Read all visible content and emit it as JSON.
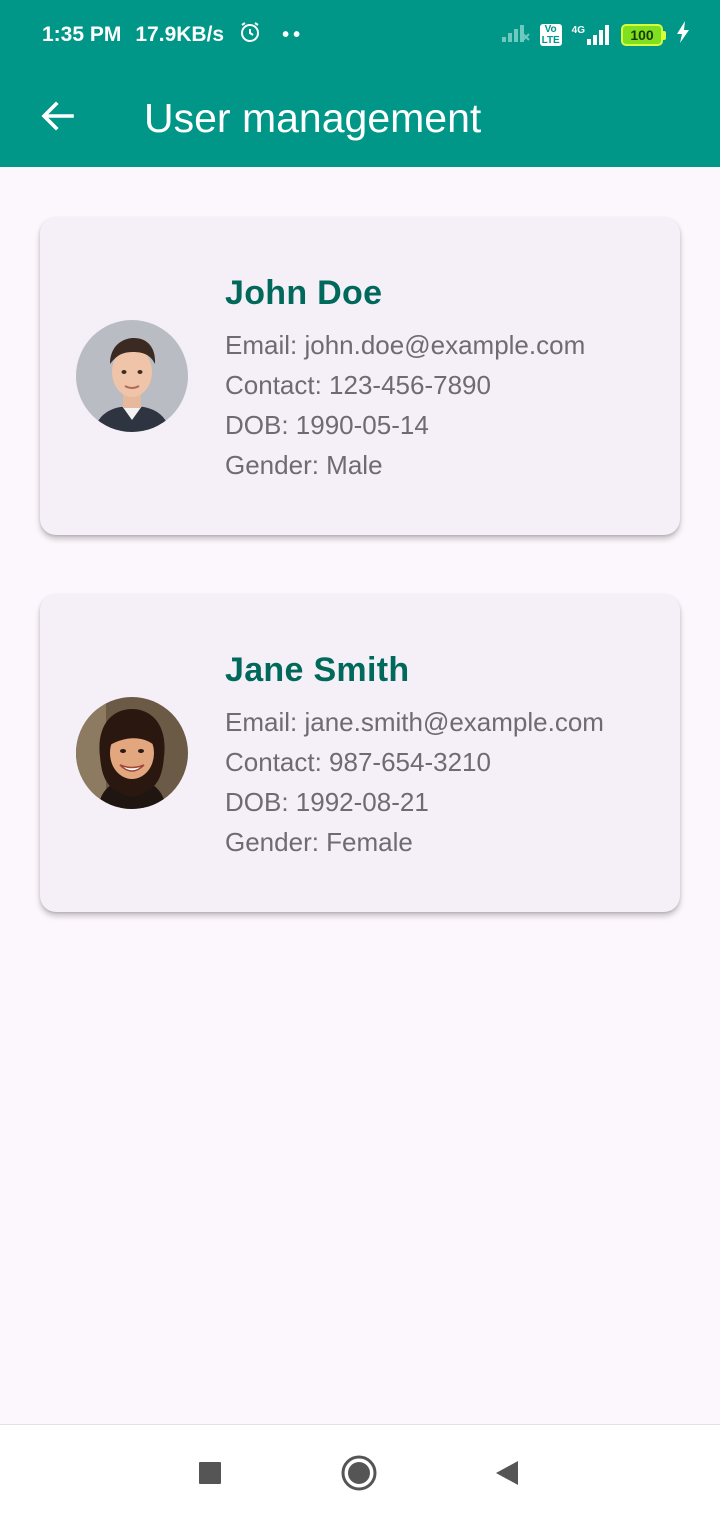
{
  "status_bar": {
    "time": "1:35 PM",
    "speed": "17.9KB/s",
    "dots": "••",
    "volte": "Vo LTE",
    "network": "4G",
    "battery": "100"
  },
  "toolbar": {
    "title": "User management"
  },
  "users": [
    {
      "name": "John Doe",
      "email": "Email: john.doe@example.com",
      "contact": "Contact: 123-456-7890",
      "dob": "DOB: 1990-05-14",
      "gender": "Gender: Male"
    },
    {
      "name": "Jane Smith",
      "email": "Email: jane.smith@example.com",
      "contact": "Contact: 987-654-3210",
      "dob": "DOB: 1992-08-21",
      "gender": "Gender: Female"
    }
  ],
  "colors": {
    "app_bar": "#009688",
    "name_text": "#00695c",
    "detail_text": "#6f6a73",
    "background": "#fcf7fc",
    "card": "#f5f0f7"
  },
  "icons": {
    "back": "arrow-back-icon",
    "alarm": "alarm-icon",
    "signal": "signal-icon",
    "battery": "battery-icon",
    "charging": "charging-icon",
    "nav_recent": "square-icon",
    "nav_home": "circle-icon",
    "nav_back": "triangle-icon"
  }
}
